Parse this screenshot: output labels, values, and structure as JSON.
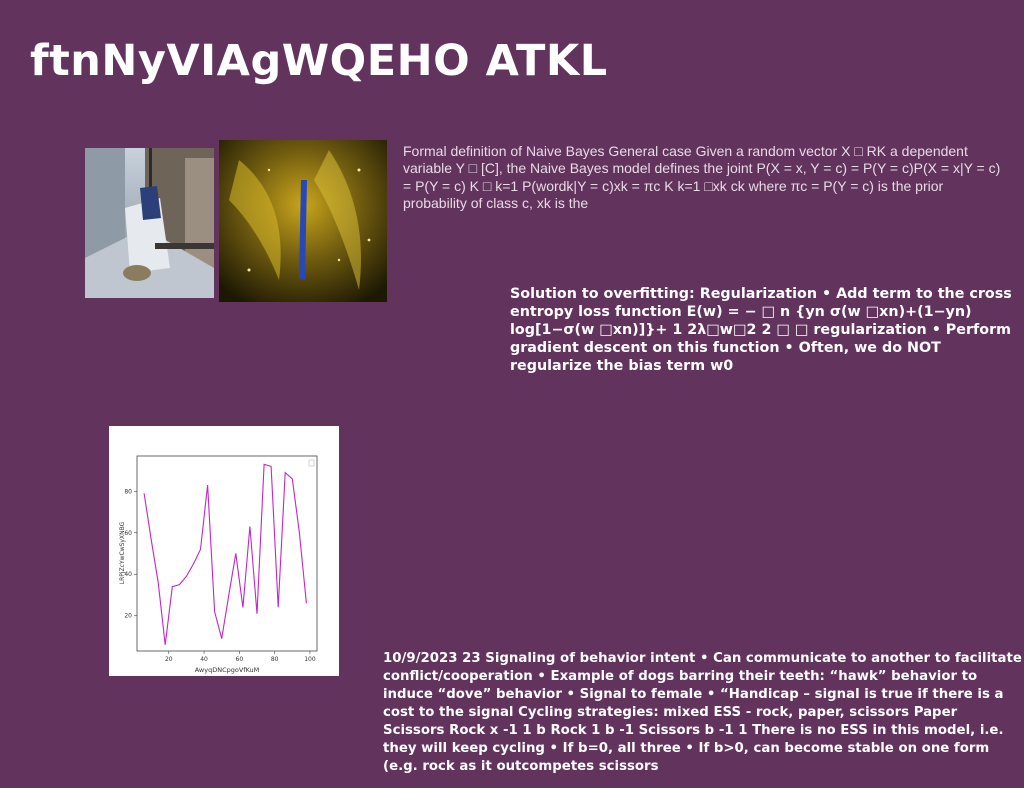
{
  "title": "ftnNyVIAgWQEHO ATKL",
  "paragraphs": {
    "naive_bayes": "Formal definition of Naive Bayes General case Given a random vector X □ RK a dependent variable Y □ [C], the Naive Bayes model defines the joint P(X = x, Y = c) = P(Y = c)P(X = x|Y = c) = P(Y = c) K □ k=1 P(wordk|Y = c)xk = πc K k=1 □xk ck where πc = P(Y = c) is the prior probability of class c, xk is the",
    "regularization": "Solution to overfitting: Regularization • Add term to the cross entropy loss function E(w) = − □ n {yn σ(w □xn)+(1−yn) log[1−σ(w □xn)]}+ 1 2λ□w□2 2 □ □ regularization • Perform gradient descent on this function • Often, we do NOT regularize the bias term w0",
    "signaling": "10/9/2023 23 Signaling of behavior intent • Can communicate to another to facilitate conflict/cooperation • Example of dogs barring their teeth: “hawk” behavior to induce “dove” behavior • Signal to female • “Handicap – signal is true if there is a cost to the signal Cycling strategies: mixed ESS - rock, paper, scissors Paper Scissors Rock x -1 1 b Rock 1 b -1 Scissors b -1 1 There is no ESS in this model, i.e. they will keep cycling • If b=0, all three • If b>0, can become stable on one form (e.g. rock as it outcompetes scissors"
  },
  "chart_data": {
    "type": "line",
    "xlabel": "AwyqDNCpgoVfKuM",
    "ylabel": "LRPjZcYwCwSyXNBG",
    "xlim": [
      2,
      104
    ],
    "ylim": [
      3,
      97
    ],
    "xticks": [
      20,
      40,
      60,
      80,
      100
    ],
    "yticks": [
      20,
      40,
      60,
      80
    ],
    "grid": false,
    "series": [
      {
        "color": "#c026c8",
        "x": [
          6,
          10,
          14,
          18,
          22,
          26,
          30,
          34,
          38,
          42,
          46,
          50,
          54,
          58,
          62,
          66,
          70,
          74,
          78,
          82,
          86,
          90,
          94,
          98
        ],
        "y": [
          79,
          57,
          36,
          6,
          34,
          35,
          39,
          45,
          52,
          83,
          22,
          9,
          30,
          50,
          24,
          63,
          21,
          93,
          92,
          24,
          89,
          86,
          60,
          26
        ]
      }
    ]
  }
}
